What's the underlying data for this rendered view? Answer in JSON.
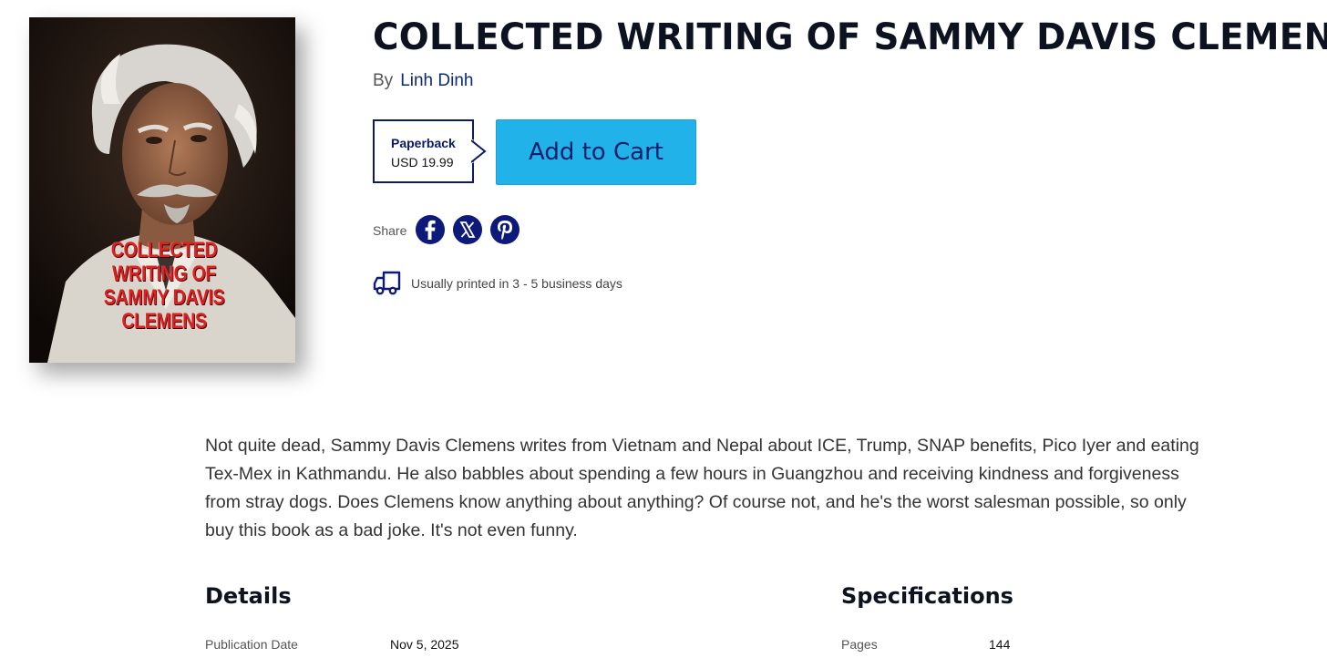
{
  "book": {
    "cover_title_lines": [
      "COLLECTED",
      "WRITING OF",
      "SAMMY DAVIS",
      "CLEMENS"
    ],
    "title": "COLLECTED WRITING OF SAMMY DAVIS CLEMENS",
    "by_label": "By",
    "author": "Linh Dinh"
  },
  "purchase": {
    "format": "Paperback",
    "price": "USD 19.99",
    "add_to_cart": "Add to Cart"
  },
  "share": {
    "label": "Share",
    "icons": [
      "facebook-icon",
      "x-icon",
      "pinterest-icon"
    ]
  },
  "shipping": {
    "text": "Usually printed in 3 - 5 business days"
  },
  "description": "Not quite dead, Sammy Davis Clemens writes from Vietnam and Nepal about ICE, Trump, SNAP benefits, Pico Iyer and eating Tex-Mex in Kathmandu. He also babbles about spending a few hours in Guangzhou and receiving kindness and forgiveness from stray dogs. Does Clemens know anything about anything? Of course not, and he's the worst salesman possible, so only buy this book as a bad joke. It's not even funny.",
  "details": {
    "heading": "Details",
    "rows": [
      {
        "label": "Publication Date",
        "value": "Nov 5, 2025"
      }
    ]
  },
  "specifications": {
    "heading": "Specifications",
    "rows": [
      {
        "label": "Pages",
        "value": "144"
      }
    ]
  },
  "colors": {
    "accent_button": "#22b2ea",
    "navy": "#0d1a7a",
    "cover_text": "#e02020"
  }
}
